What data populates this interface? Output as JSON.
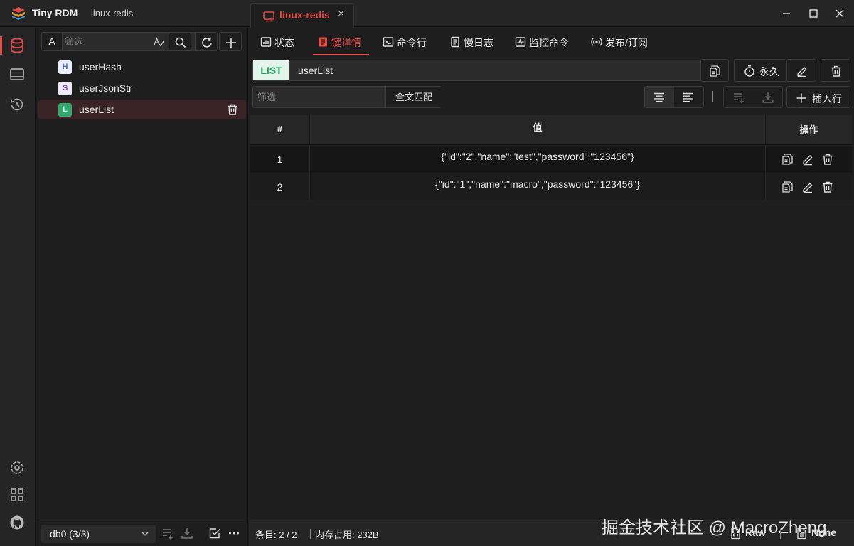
{
  "app": {
    "title": "Tiny RDM",
    "subtitle": "linux-redis",
    "tab_label": "linux-redis",
    "tab_close": "×"
  },
  "sidebar": {
    "filter_mode_label": "A",
    "filter_placeholder": "筛选",
    "keys": [
      {
        "badge": "H",
        "name": "userHash"
      },
      {
        "badge": "S",
        "name": "userJsonStr"
      },
      {
        "badge": "L",
        "name": "userList",
        "selected": true
      }
    ],
    "db_select": "db0 (3/3)"
  },
  "nav": {
    "tabs": [
      {
        "label": "状态",
        "icon": "status-icon"
      },
      {
        "label": "键详情",
        "icon": "key-detail-icon",
        "active": true
      },
      {
        "label": "命令行",
        "icon": "terminal-icon"
      },
      {
        "label": "慢日志",
        "icon": "slow-log-icon"
      },
      {
        "label": "监控命令",
        "icon": "monitor-icon"
      },
      {
        "label": "发布/订阅",
        "icon": "pubsub-icon"
      }
    ]
  },
  "key_detail": {
    "type": "LIST",
    "key_name": "userList",
    "ttl_label": "永久",
    "filter_placeholder": "筛选",
    "fulltext_label": "全文匹配",
    "insert_row_label": "插入行"
  },
  "table": {
    "columns": [
      "#",
      "值",
      "操作"
    ],
    "rows": [
      {
        "index": "1",
        "value": "{\"id\":\"2\",\"name\":\"test\",\"password\":\"123456\"}"
      },
      {
        "index": "2",
        "value": "{\"id\":\"1\",\"name\":\"macro\",\"password\":\"123456\"}"
      }
    ]
  },
  "status_bar": {
    "entries": "条目: 2 / 2",
    "memory": "内存占用: 232B",
    "watermark": "掘金技术社区 @ MacroZheng",
    "view_format": "Raw",
    "decode_format": "None"
  },
  "colors": {
    "accent": "#e04b45",
    "list_badge": "#2faa6c",
    "type_tag_bg": "#e3f5ea",
    "type_tag_fg": "#18a058"
  }
}
